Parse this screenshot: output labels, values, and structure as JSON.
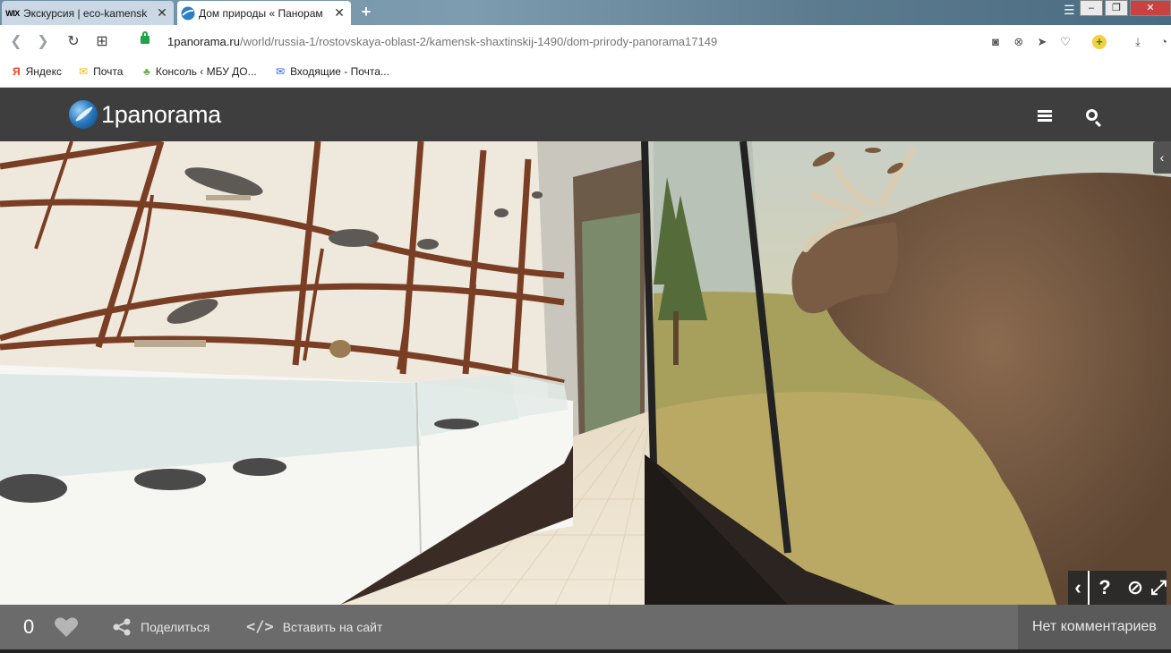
{
  "browser": {
    "tabs": [
      {
        "title": "Экскурсия | eco-kamensk",
        "favicon": "wix-logo",
        "favicon_text": "WIX",
        "active": false
      },
      {
        "title": "Дом природы « Панорам",
        "favicon": "1panorama-globe-icon",
        "active": true
      }
    ],
    "new_tab": "+",
    "url_host": "1panorama.ru",
    "url_path": "/world/russia-1/rostovskaya-oblast-2/kamensk-shaxtinskij-1490/dom-prirody-panorama17149",
    "bookmarks": [
      {
        "label": "Яндекс",
        "icon": "yandex-icon",
        "glyph": "Я",
        "color": "#fc3f1d"
      },
      {
        "label": "Почта",
        "icon": "mail-icon",
        "glyph": "✉",
        "color": "#f5b800"
      },
      {
        "label": "Консоль ‹ МБУ ДО...",
        "icon": "tree-icon",
        "glyph": "♣",
        "color": "#6ab04c"
      },
      {
        "label": "Входящие - Почта...",
        "icon": "inbox-icon",
        "glyph": "✉",
        "color": "#2962ff"
      }
    ]
  },
  "site": {
    "logo_text": "1panorama",
    "menu_icon": "hamburger-menu-icon",
    "search_icon": "search-icon"
  },
  "viewer": {
    "controls": [
      {
        "name": "collapse-arrow-icon",
        "glyph": "‹"
      },
      {
        "name": "help-icon",
        "glyph": "?"
      },
      {
        "name": "hide-icon",
        "glyph": "⊘"
      },
      {
        "name": "fullscreen-icon",
        "glyph": "⤢"
      }
    ]
  },
  "footer": {
    "likes_count": "0",
    "share_label": "Поделиться",
    "embed_code": "</>",
    "embed_label": "Вставить на сайт",
    "comments_label": "Нет комментариев"
  },
  "colors": {
    "header_bg": "#3e3e3e",
    "footer_bg": "#6b6b6b",
    "accent_green": "#1ea446"
  }
}
